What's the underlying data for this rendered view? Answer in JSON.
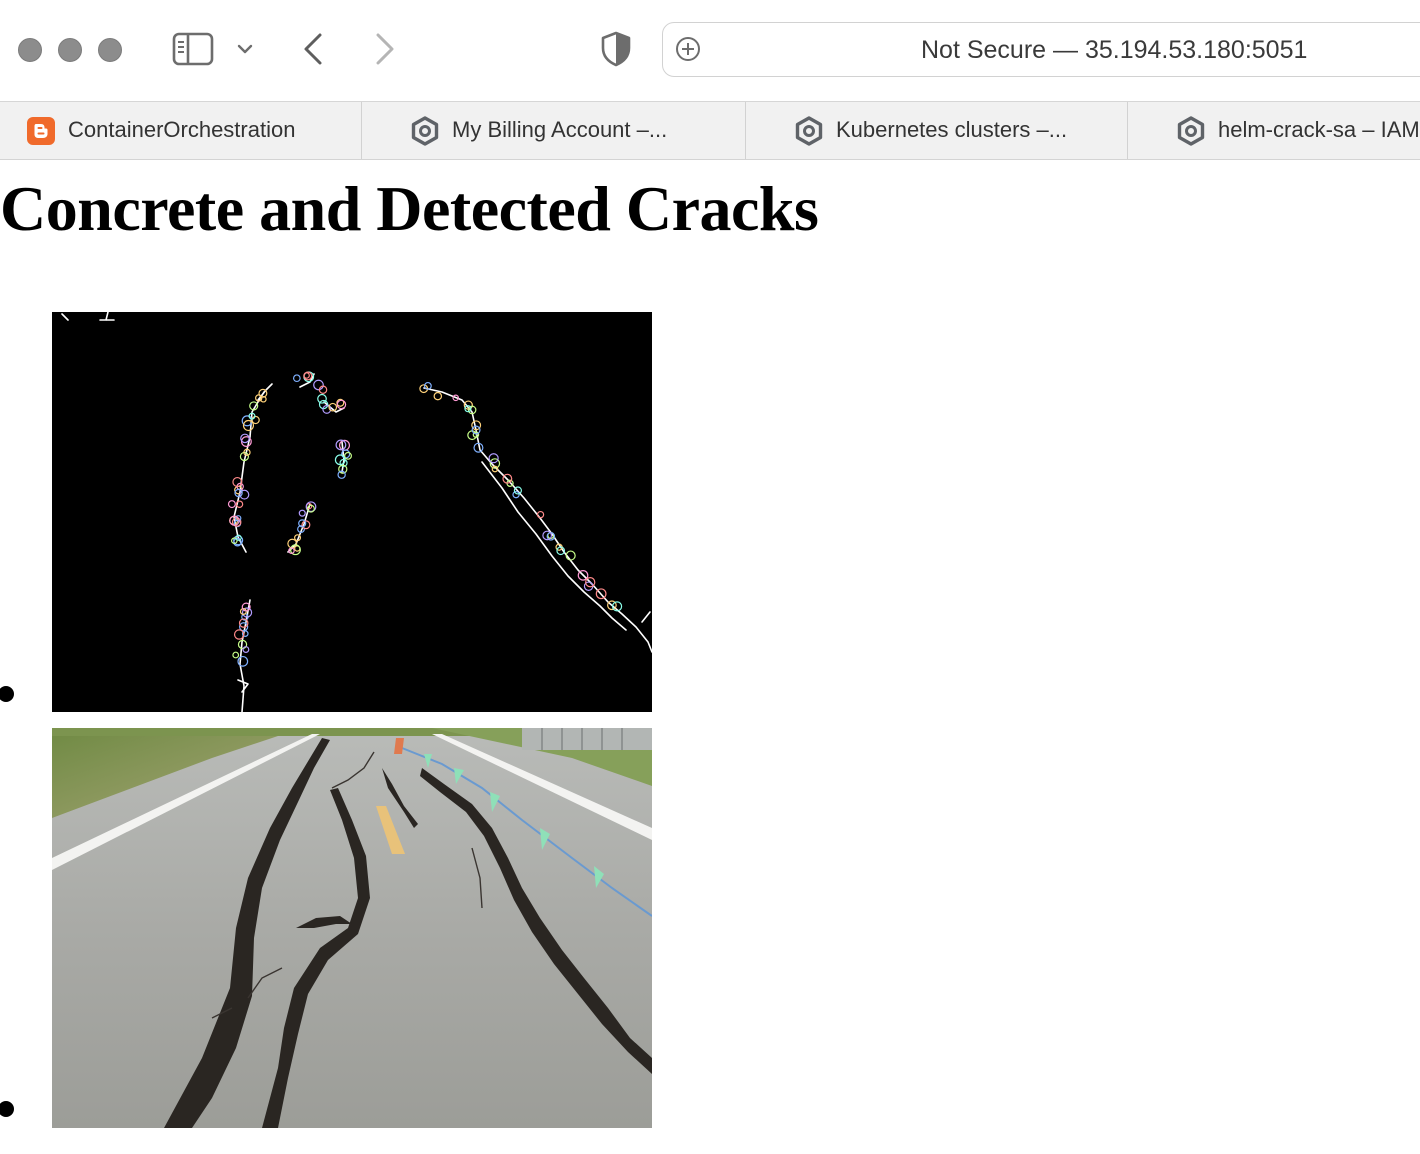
{
  "browser": {
    "url_text": "Not Secure — 35.194.53.180:5051",
    "tabs": [
      {
        "label": "ContainerOrchestration",
        "icon": "blogger-icon"
      },
      {
        "label": "My Billing Account –...",
        "icon": "google-cloud-icon"
      },
      {
        "label": "Kubernetes clusters –...",
        "icon": "google-cloud-icon"
      },
      {
        "label": "helm-crack-sa – IAM",
        "icon": "google-cloud-icon"
      }
    ]
  },
  "page": {
    "title": "Concrete and Detected Cracks",
    "images": [
      {
        "name": "detected-cracks-image"
      },
      {
        "name": "concrete-road-image"
      }
    ]
  },
  "colors": {
    "blogger_orange": "#f06a2b",
    "tab_bg": "#f1f1f1",
    "traffic_grey": "#8c8c8c"
  }
}
